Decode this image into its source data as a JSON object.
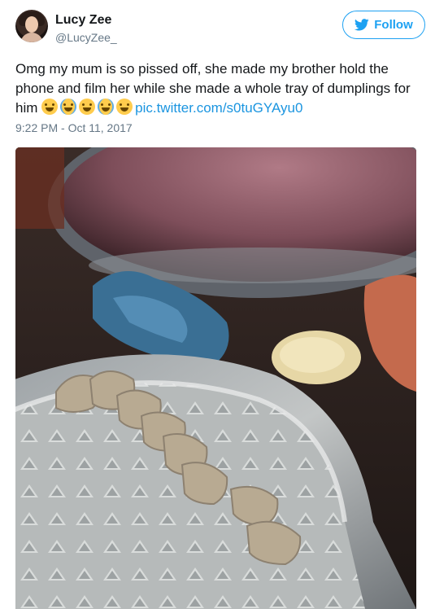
{
  "user": {
    "name": "Lucy Zee",
    "handle": "@LucyZee_",
    "avatar_icon": "profile-photo"
  },
  "follow_button": {
    "label": "Follow",
    "icon": "twitter-bird-icon",
    "color": "#1da1f2"
  },
  "tweet": {
    "text_part1": "Omg my mum is so pissed off, she made my brother hold the phone and film her while she made a whole tray of dumplings for him ",
    "emojis": [
      "face-with-tears-of-joy",
      "loudly-crying-face",
      "face-with-tears-of-joy",
      "loudly-crying-face",
      "face-with-tears-of-joy"
    ],
    "link": "pic.twitter.com/s0tuGYAyu0",
    "timestamp": "9:22 PM - Oct 11, 2017"
  },
  "media": {
    "type": "video-thumbnail"
  }
}
